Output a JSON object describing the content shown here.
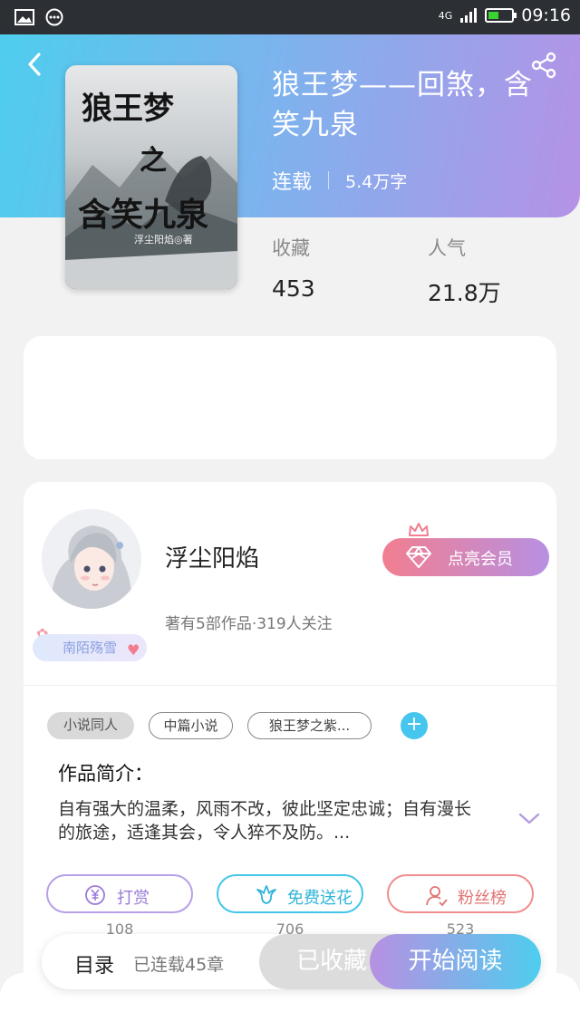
{
  "status_bar": {
    "time": "09:16",
    "network": "4G"
  },
  "book": {
    "title": "狼王梦——回煞，含笑九泉",
    "status": "连载",
    "word_count": "5.4万字",
    "cover_title_1": "狼王梦",
    "cover_title_2": "之",
    "cover_title_3": "含笑九泉",
    "cover_author": "浮尘阳焰◎著",
    "favorites_label": "收藏",
    "favorites_value": "453",
    "popularity_label": "人气",
    "popularity_value": "21.8万"
  },
  "author": {
    "name": "浮尘阳焰",
    "info": "著有5部作品·319人关注",
    "badge": "南陌殇雪",
    "vip_button": "点亮会员"
  },
  "tags": [
    "小说同人",
    "中篇小说",
    "狼王梦之紫..."
  ],
  "intro": {
    "heading": "作品简介：",
    "text": "自有强大的温柔，风雨不改，彼此坚定忠诚；自有漫长的旅途，适逢其会，令人猝不及防。..."
  },
  "actions": [
    {
      "label": "打赏",
      "count": "108"
    },
    {
      "label": "免费送花",
      "count": "706"
    },
    {
      "label": "粉丝榜",
      "count": "523"
    }
  ],
  "bottom_bar": {
    "toc": "目录",
    "chapters": "已连载45章",
    "collected": "已收藏",
    "read": "开始阅读"
  }
}
